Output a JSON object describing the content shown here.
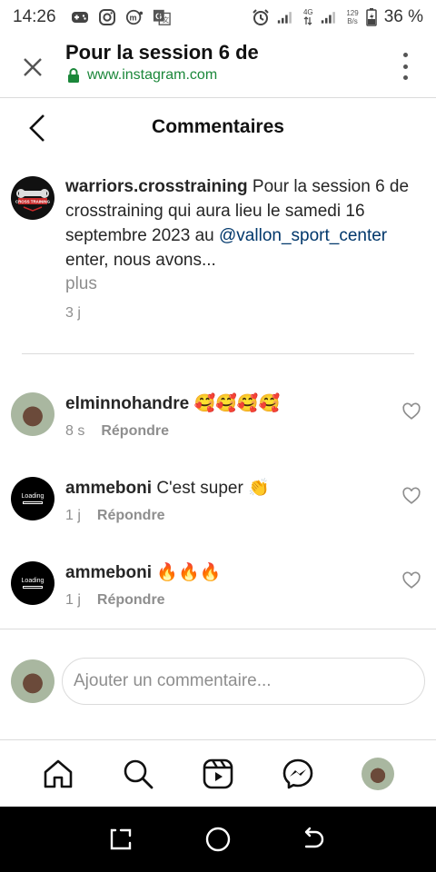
{
  "status_bar": {
    "time": "14:26",
    "network_type": "4G",
    "net_speed_value": "129",
    "net_speed_unit": "B/s",
    "battery_percent": "36 %"
  },
  "browser": {
    "tab_title": "Pour la session 6 de",
    "url": "www.instagram.com"
  },
  "page": {
    "title": "Commentaires"
  },
  "caption": {
    "username": "warriors.crosstraining",
    "text_before_mention": " Pour la session 6 de crosstraining qui aura lieu le samedi 16 septembre 2023 au ",
    "mention": "@vallon_sport_center",
    "text_after_mention": " enter, nous avons...",
    "more_label": "plus",
    "time": "3 j",
    "avatar_text": "CROSS TRAINING"
  },
  "comments": [
    {
      "username": "elminnohandre",
      "text": "🥰🥰🥰🥰",
      "time": "8 s",
      "reply_label": "Répondre"
    },
    {
      "username": "ammeboni",
      "text": "C'est super 👏",
      "time": "1 j",
      "reply_label": "Répondre",
      "avatar_text": "Loading"
    },
    {
      "username": "ammeboni",
      "text": "🔥🔥🔥",
      "time": "1 j",
      "reply_label": "Répondre",
      "avatar_text": "Loading"
    }
  ],
  "add_comment": {
    "placeholder": "Ajouter un commentaire..."
  },
  "bottom_nav": [
    "home-icon",
    "search-icon",
    "reels-icon",
    "messenger-icon",
    "profile-avatar"
  ],
  "colors": {
    "url_green": "#1b873a",
    "mention_blue": "#00376b",
    "secondary_text": "#8e8e8e",
    "divider": "#dbdbdb"
  }
}
